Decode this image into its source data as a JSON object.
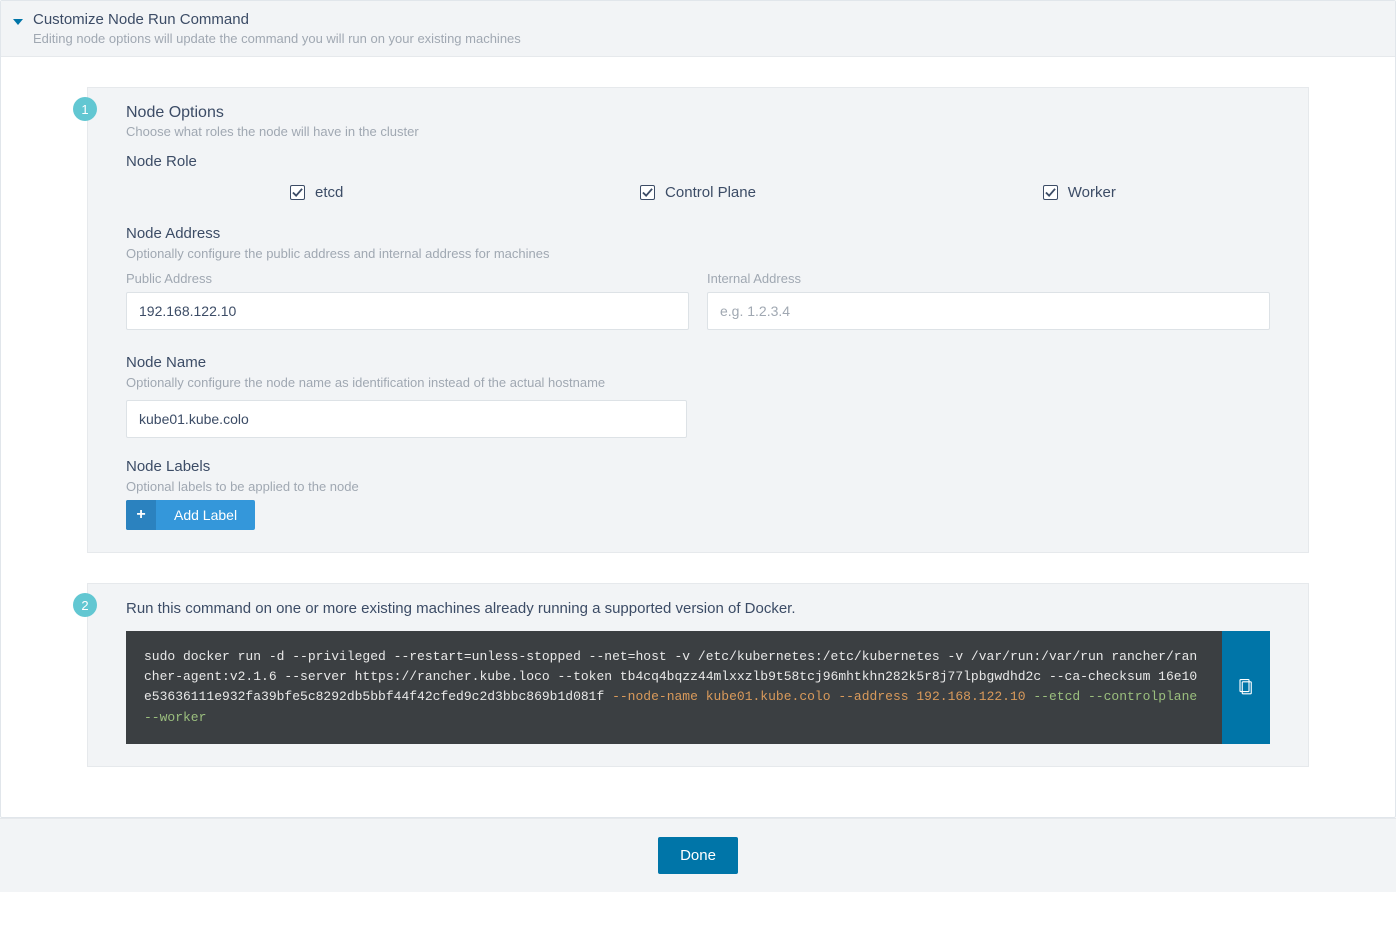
{
  "header": {
    "title": "Customize Node Run Command",
    "subtitle": "Editing node options will update the command you will run on your existing machines"
  },
  "step1": {
    "badge": "1",
    "title": "Node Options",
    "subtitle": "Choose what roles the node will have in the cluster",
    "role_label": "Node Role",
    "roles": {
      "etcd": "etcd",
      "control_plane": "Control Plane",
      "worker": "Worker"
    },
    "address": {
      "title": "Node Address",
      "subtitle": "Optionally configure the public address and internal address for machines",
      "public_label": "Public Address",
      "public_value": "192.168.122.10",
      "internal_label": "Internal Address",
      "internal_placeholder": "e.g. 1.2.3.4"
    },
    "name": {
      "title": "Node Name",
      "subtitle": "Optionally configure the node name as identification instead of the actual hostname",
      "value": "kube01.kube.colo"
    },
    "labels": {
      "title": "Node Labels",
      "subtitle": "Optional labels to be applied to the node",
      "add_btn": "Add Label"
    }
  },
  "step2": {
    "badge": "2",
    "title": "Run this command on one or more existing machines already running a supported version of Docker.",
    "command": {
      "p1": "sudo docker run -d --privileged --restart=unless-stopped --net=host -v /etc/kubernetes:/etc/kubernetes -v /var/run:/var/run rancher/rancher-agent:v2.1.6 --server https://rancher.kube.loco --token tb4cq4bqzz44mlxxzlb9t58tcj96mhtkhn282k5r8j77lpbgwdhd2c --ca-checksum 16e10e53636111e932fa39bfe5c8292db5bbf44f42cfed9c2d3bbc869b1d081f",
      "node_name_flag": " --node-name ",
      "node_name_val": "kube01.kube.colo",
      "address_flag": " --address ",
      "address_val": "192.168.122.10",
      "roles": " --etcd --controlplane --worker"
    }
  },
  "footer": {
    "done": "Done"
  }
}
